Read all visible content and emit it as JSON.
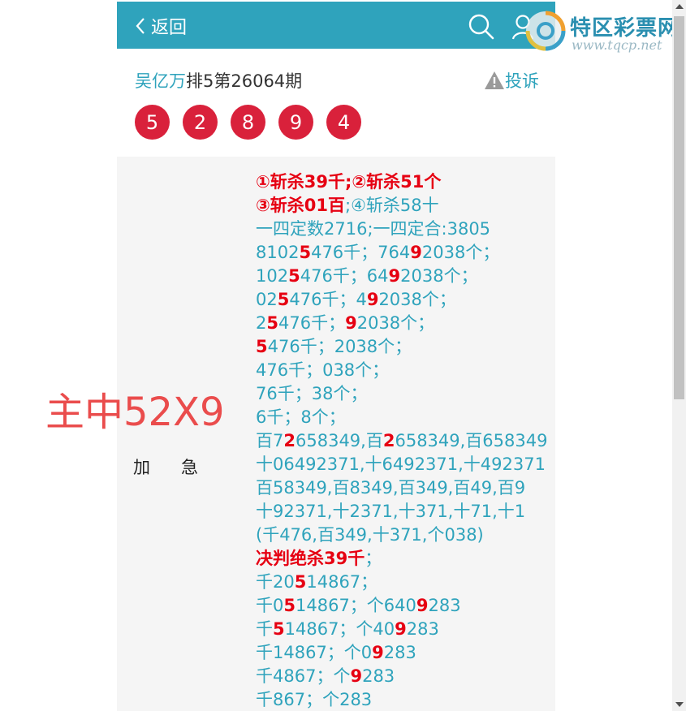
{
  "header": {
    "back_label": "返回"
  },
  "title": {
    "author": "吴亿万",
    "rest": "排5第26064期",
    "complain_label": "投诉"
  },
  "balls": [
    "5",
    "2",
    "8",
    "9",
    "4"
  ],
  "side_label": "加急",
  "overlay_text": "主中52X9",
  "watermark": {
    "title": "特区彩票网",
    "url": "www.tqcp.net"
  },
  "lines": [
    [
      {
        "t": "①斩杀39千;②斩杀51个",
        "r": true
      }
    ],
    [
      {
        "t": "③斩杀01百",
        "r": true
      },
      {
        "t": ";④斩杀58十"
      }
    ],
    [
      {
        "t": "一四定数2716;一四定合:3805"
      }
    ],
    [
      {
        "t": "8102"
      },
      {
        "t": "5",
        "r": true
      },
      {
        "t": "476千；764"
      },
      {
        "t": "9",
        "r": true
      },
      {
        "t": "2038个；"
      }
    ],
    [
      {
        "t": "102"
      },
      {
        "t": "5",
        "r": true
      },
      {
        "t": "476千；64"
      },
      {
        "t": "9",
        "r": true
      },
      {
        "t": "2038个；"
      }
    ],
    [
      {
        "t": "02"
      },
      {
        "t": "5",
        "r": true
      },
      {
        "t": "476千；4"
      },
      {
        "t": "9",
        "r": true
      },
      {
        "t": "2038个；"
      }
    ],
    [
      {
        "t": "2"
      },
      {
        "t": "5",
        "r": true
      },
      {
        "t": "476千；"
      },
      {
        "t": "9",
        "r": true
      },
      {
        "t": "2038个；"
      }
    ],
    [
      {
        "t": "5",
        "r": true
      },
      {
        "t": "476千；2038个；"
      }
    ],
    [
      {
        "t": "476千；038个；"
      }
    ],
    [
      {
        "t": "76千；38个；"
      }
    ],
    [
      {
        "t": "6千；8个；"
      }
    ],
    [
      {
        "t": "百7"
      },
      {
        "t": "2",
        "r": true
      },
      {
        "t": "658349,百"
      },
      {
        "t": "2",
        "r": true
      },
      {
        "t": "658349,百658349"
      }
    ],
    [
      {
        "t": "十06492371,十6492371,十492371"
      }
    ],
    [
      {
        "t": "百58349,百8349,百349,百49,百9"
      }
    ],
    [
      {
        "t": "十92371,十2371,十371,十71,十1"
      }
    ],
    [
      {
        "t": "(千476,百349,十371,个038)"
      }
    ],
    [
      {
        "t": "决判绝杀39千",
        "r": true
      },
      {
        "t": "；"
      }
    ],
    [
      {
        "t": "千20"
      },
      {
        "t": "5",
        "r": true
      },
      {
        "t": "14867；"
      }
    ],
    [
      {
        "t": "千0"
      },
      {
        "t": "5",
        "r": true
      },
      {
        "t": "14867；个640"
      },
      {
        "t": "9",
        "r": true
      },
      {
        "t": "283"
      }
    ],
    [
      {
        "t": "千"
      },
      {
        "t": "5",
        "r": true
      },
      {
        "t": "14867；个40"
      },
      {
        "t": "9",
        "r": true
      },
      {
        "t": "283"
      }
    ],
    [
      {
        "t": "千14867；个0"
      },
      {
        "t": "9",
        "r": true
      },
      {
        "t": "283"
      }
    ],
    [
      {
        "t": "千4867；个"
      },
      {
        "t": "9",
        "r": true
      },
      {
        "t": "283"
      }
    ],
    [
      {
        "t": "千867；个283"
      }
    ]
  ]
}
